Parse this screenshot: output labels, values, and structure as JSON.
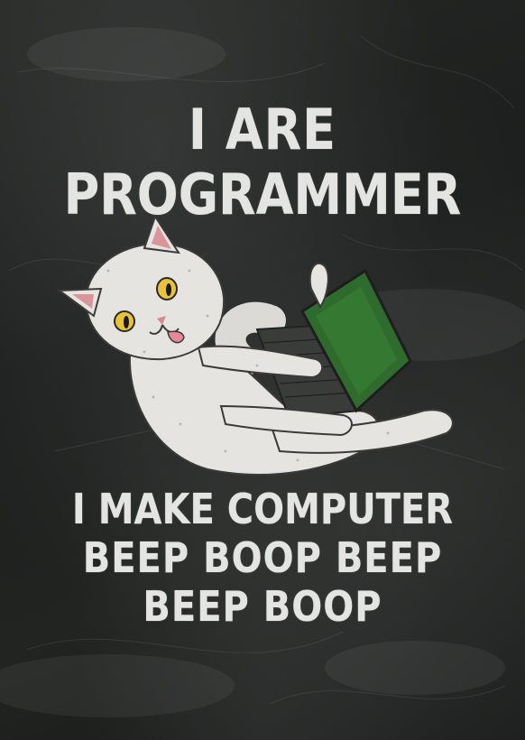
{
  "headline": {
    "line1": "I ARE",
    "line2": "PROGRAMMER"
  },
  "tagline": {
    "line1": "I MAKE COMPUTER",
    "line2": "BEEP BOOP BEEP",
    "line3": "BEEP BOOP"
  },
  "colors": {
    "background": "#1f211f",
    "text": "#e4e4e2",
    "cat_fur": "#e6e4e0",
    "laptop_screen": "#2f6b2c",
    "cat_eyes": "#e8c23a"
  },
  "icons": {
    "illustration": "cat-with-laptop-icon"
  }
}
